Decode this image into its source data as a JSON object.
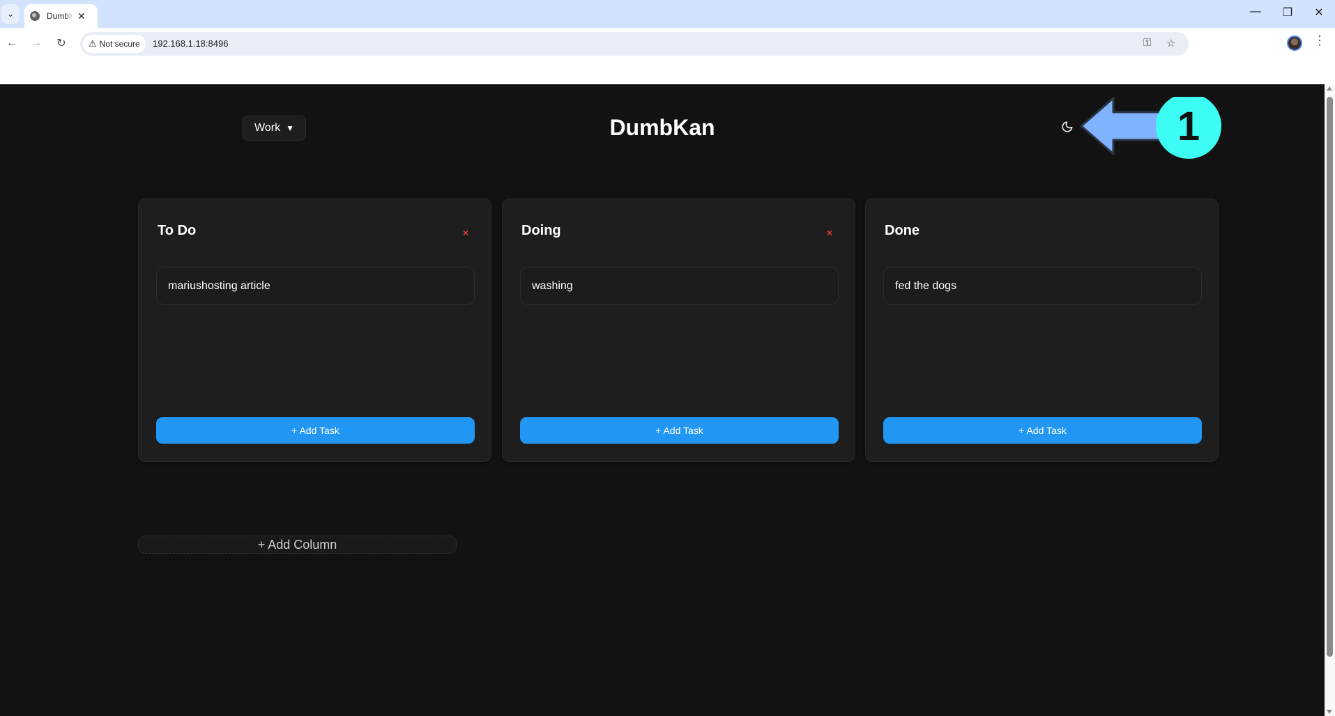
{
  "browser": {
    "tab_title": "DumbKan",
    "url": "192.168.1.18:8496",
    "security_label": "Not secure",
    "icons": {
      "tab_list": "chevron-down-icon",
      "tab_favicon": "globe-icon",
      "tab_close": "close-icon",
      "minimize": "minimize-icon",
      "restore": "restore-icon",
      "close_window": "close-icon",
      "back": "arrow-left-icon",
      "forward": "arrow-right-icon",
      "reload": "reload-icon",
      "warning": "warning-triangle-icon",
      "password": "key-icon",
      "bookmark": "star-icon",
      "profile": "avatar",
      "menu": "kebab-menu-icon"
    },
    "glyphs": {
      "tab_list": "⌄",
      "tab_close": "✕",
      "minimize": "—",
      "restore": "❐",
      "close_window": "✕",
      "back": "←",
      "forward": "→",
      "reload": "↻",
      "warning": "⚠",
      "password": "⚿",
      "bookmark": "☆",
      "menu": "⋮"
    }
  },
  "app": {
    "title": "DumbKan",
    "board_selector": {
      "selected": "Work",
      "caret": "▼"
    },
    "theme_toggle_icon": "moon-icon",
    "columns": [
      {
        "title": "To Do",
        "deletable": true,
        "delete_glyph": "×",
        "tasks": [
          "mariushosting article"
        ],
        "add_task_label": "+ Add Task"
      },
      {
        "title": "Doing",
        "deletable": true,
        "delete_glyph": "×",
        "tasks": [
          "washing"
        ],
        "add_task_label": "+ Add Task"
      },
      {
        "title": "Done",
        "deletable": false,
        "delete_glyph": "",
        "tasks": [
          "fed the dogs"
        ],
        "add_task_label": "+ Add Task"
      }
    ],
    "add_column_label": "+ Add Column",
    "colors": {
      "background": "#121212",
      "column_bg": "#1e1e1e",
      "accent": "#2196f3",
      "delete": "#e53935"
    }
  },
  "annotation": {
    "step_number": "1",
    "arrow_color": "#7fb2ff",
    "badge_color": "#3dfcf4"
  }
}
